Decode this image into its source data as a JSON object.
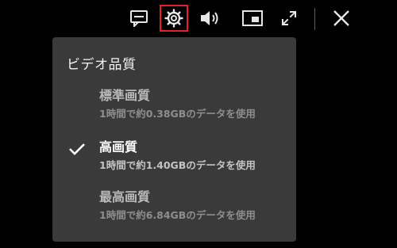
{
  "toolbar": {
    "icons": [
      "subtitles-icon",
      "gear-icon",
      "volume-icon",
      "picture-in-picture-icon",
      "fullscreen-icon",
      "close-icon"
    ],
    "highlight_color": "#e8202a"
  },
  "quality_menu": {
    "title": "ビデオ品質",
    "options": [
      {
        "label": "標準画質",
        "detail": "1時間で約0.38GBのデータを使用",
        "selected": false
      },
      {
        "label": "高画質",
        "detail": "1時間で約1.40GBのデータを使用",
        "selected": true
      },
      {
        "label": "最高画質",
        "detail": "1時間で約6.84GBのデータを使用",
        "selected": false
      }
    ]
  }
}
